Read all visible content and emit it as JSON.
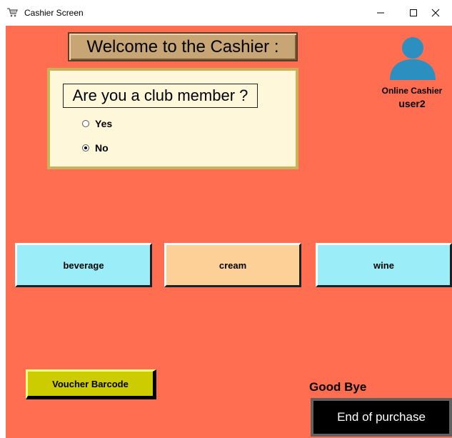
{
  "window": {
    "title": "Cashier Screen",
    "icons": {
      "app": "shopping-cart-icon",
      "minimize": "minimize-icon",
      "maximize": "maximize-icon",
      "close": "close-icon"
    }
  },
  "colors": {
    "background": "#ff6e50",
    "welcome_bg": "#c8a575",
    "panel_bg": "#fff7d9",
    "panel_border": "#c9b25a",
    "beverage": "#9beef8",
    "cream": "#fcd096",
    "wine": "#9beef8",
    "voucher": "#cccc00",
    "end_purchase": "#000000",
    "user_icon": "#2b8fc0"
  },
  "welcome": {
    "text": "Welcome to the Cashier :"
  },
  "membership": {
    "question": "Are you a club member ?",
    "options": [
      {
        "label": "Yes",
        "checked": false
      },
      {
        "label": "No",
        "checked": true
      }
    ]
  },
  "user": {
    "icon": "user-avatar-icon",
    "role_label": "Online Cashier",
    "username": "user2"
  },
  "categories": [
    {
      "label": "beverage"
    },
    {
      "label": "cream"
    },
    {
      "label": "wine"
    }
  ],
  "footer": {
    "voucher_label": "Voucher Barcode",
    "goodbye_text": "Good Bye",
    "end_purchase_label": "End of purchase"
  }
}
